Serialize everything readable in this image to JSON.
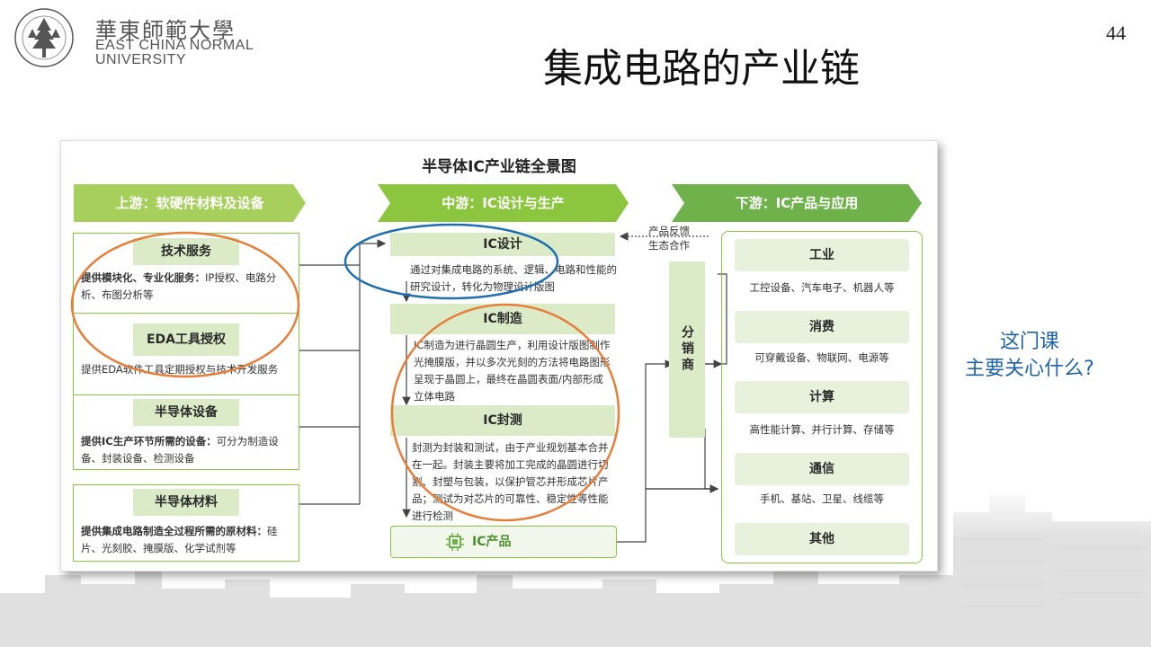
{
  "header": {
    "logo_cn": "華東師範大學",
    "logo_en_line1": "EAST CHINA NORMAL",
    "logo_en_line2": "UNIVERSITY",
    "seal_text": "EAST CHINA NORMAL UNIVERSITY 華東師範大學",
    "page_number": "44"
  },
  "slide": {
    "title": "集成电路的产业链",
    "side_question_line1": "这门课",
    "side_question_line2": "主要关心什么?"
  },
  "diagram": {
    "title": "半导体IC产业链全景图",
    "upstream": {
      "band": "上游：软硬件材料及设备",
      "items": [
        {
          "header": "技术服务",
          "text_bold": "提供模块化、专业化服务：",
          "text": "IP授权、电路分析、布图分析等"
        },
        {
          "header": "EDA工具授权",
          "text_bold": "",
          "text": "提供EDA软件工具定期授权与技术开发服务"
        },
        {
          "header": "半导体设备",
          "text_bold": "提供IC生产环节所需的设备：",
          "text": "可分为制造设备、封装设备、检测设备"
        },
        {
          "header": "半导体材料",
          "text_bold": "提供集成电路制造全过程所需的原材料：",
          "text": "硅片、光刻胶、掩膜版、化学试剂等"
        }
      ]
    },
    "midstream": {
      "band": "中游：IC设计与生产",
      "design": {
        "header": "IC设计",
        "text": "通过对集成电路的系统、逻辑、电路和性能的研究设计，转化为物理设计版图"
      },
      "manufacture": {
        "header": "IC制造",
        "text": "IC制造为进行晶圆生产，利用设计版图制作光掩膜版，并以多次光刻的方法将电路图形呈现于晶圆上，最终在晶圆表面/内部形成立体电路"
      },
      "packaging": {
        "header": "IC封测",
        "text": "封测为封装和测试，由于产业规划基本合并在一起。封装主要将加工完成的晶圆进行切割、封塑与包装，以保护管芯并形成芯片产品；测试为对芯片的可靠性、稳定性等性能进行检测"
      },
      "product": {
        "label": "IC产品",
        "icon": "chip-icon"
      }
    },
    "feedback": {
      "line1": "产品反馈",
      "line2": "生态合作"
    },
    "distributor": "分销商",
    "downstream": {
      "band": "下游：IC产品与应用",
      "items": [
        {
          "header": "工业",
          "text": "工控设备、汽车电子、机器人等"
        },
        {
          "header": "消费",
          "text": "可穿戴设备、物联网、电源等"
        },
        {
          "header": "计算",
          "text": "高性能计算、并行计算、存储等"
        },
        {
          "header": "通信",
          "text": "手机、基站、卫星、线缆等"
        },
        {
          "header": "其他",
          "text": ""
        }
      ]
    },
    "colors": {
      "band_light": "#a6cf5c",
      "band_mid": "#8cc63f",
      "band_dark": "#6fb14a",
      "box_border": "#8cc63f",
      "header_fill": "#dcebc7",
      "orange_annotation": "#e57f3a",
      "blue_annotation": "#1f6fb0",
      "question_text": "#1f64a8"
    }
  }
}
